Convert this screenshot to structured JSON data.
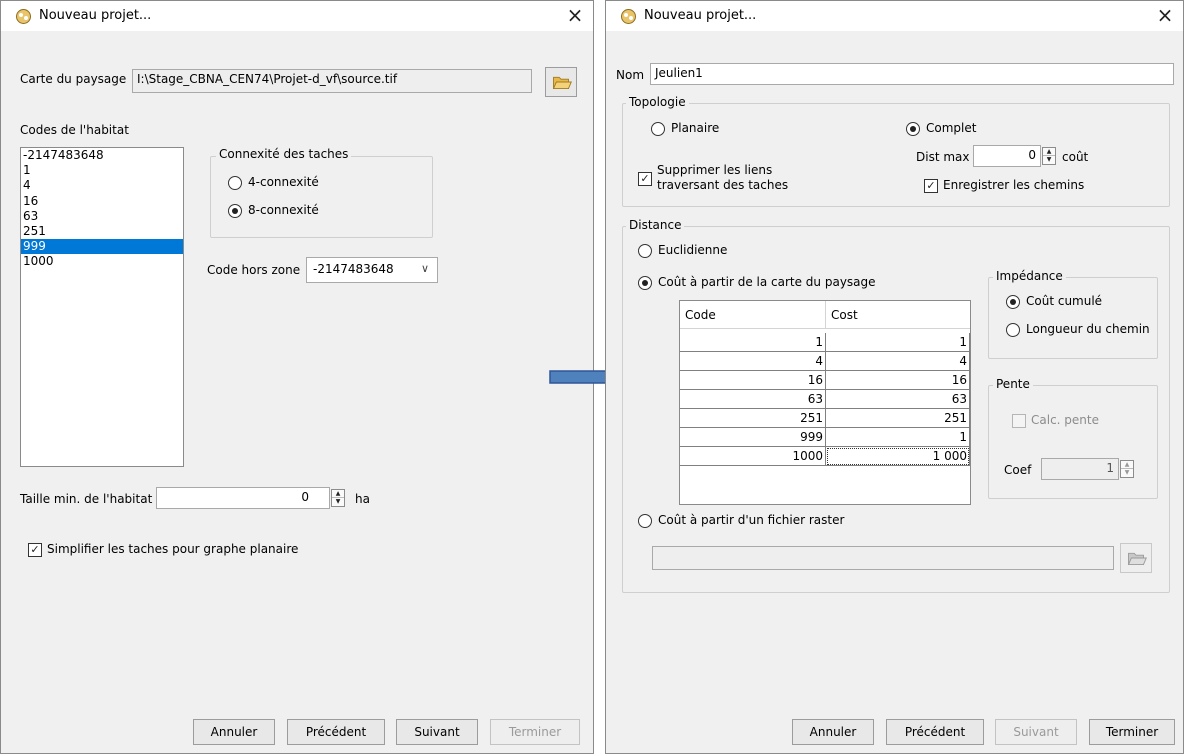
{
  "colors": {
    "selection": "#0078d7",
    "arrow": "#4f81bd"
  },
  "dialog1": {
    "title": "Nouveau projet...",
    "close_icon": "×",
    "landscape_label": "Carte du paysage",
    "landscape_path": "I:\\Stage_CBNA_CEN74\\Projet-d_vf\\source.tif",
    "habitat_codes_label": "Codes de l'habitat",
    "habitat_codes": [
      "-2147483648",
      "1",
      "4",
      "16",
      "63",
      "251",
      "999",
      "1000"
    ],
    "selected_code": "999",
    "connexity": {
      "title": "Connexité des taches",
      "option4": "4-connexité",
      "option8": "8-connexité",
      "selected": "8-connexité"
    },
    "nodata_label": "Code hors zone",
    "nodata_value": "-2147483648",
    "min_size_label": "Taille min. de l'habitat",
    "min_size_value": "0",
    "min_size_unit": "ha",
    "simplify_label": "Simplifier les taches pour graphe planaire",
    "buttons": {
      "cancel": "Annuler",
      "previous": "Précédent",
      "next": "Suivant",
      "finish": "Terminer"
    }
  },
  "dialog2": {
    "title": "Nouveau projet...",
    "close_icon": "×",
    "name_label": "Nom",
    "name_value": "Jeulien1",
    "topology": {
      "title": "Topologie",
      "planar": "Planaire",
      "complete": "Complet",
      "selected": "Complet",
      "remove_links_line1": "Supprimer les liens",
      "remove_links_line2": "traversant des taches",
      "dist_max_label": "Dist max",
      "dist_max_value": "0",
      "dist_max_unit": "coût",
      "save_paths": "Enregistrer les chemins"
    },
    "distance": {
      "title": "Distance",
      "euclidean": "Euclidienne",
      "cost_landscape": "Coût à partir de la carte du paysage",
      "cost_raster": "Coût à partir d'un fichier raster",
      "selected": "Coût à partir de la carte du paysage",
      "table": {
        "headers": [
          "Code",
          "Cost"
        ],
        "rows": [
          [
            "1",
            "1"
          ],
          [
            "4",
            "4"
          ],
          [
            "16",
            "16"
          ],
          [
            "63",
            "63"
          ],
          [
            "251",
            "251"
          ],
          [
            "999",
            "1"
          ],
          [
            "1000",
            "1 000"
          ]
        ]
      },
      "impedance": {
        "title": "Impédance",
        "cumulative": "Coût cumulé",
        "path_length": "Longueur du chemin",
        "selected": "Coût cumulé"
      },
      "slope": {
        "title": "Pente",
        "calc_label": "Calc. pente",
        "coef_label": "Coef",
        "coef_value": "1"
      }
    },
    "buttons": {
      "cancel": "Annuler",
      "previous": "Précédent",
      "next": "Suivant",
      "finish": "Terminer"
    }
  }
}
